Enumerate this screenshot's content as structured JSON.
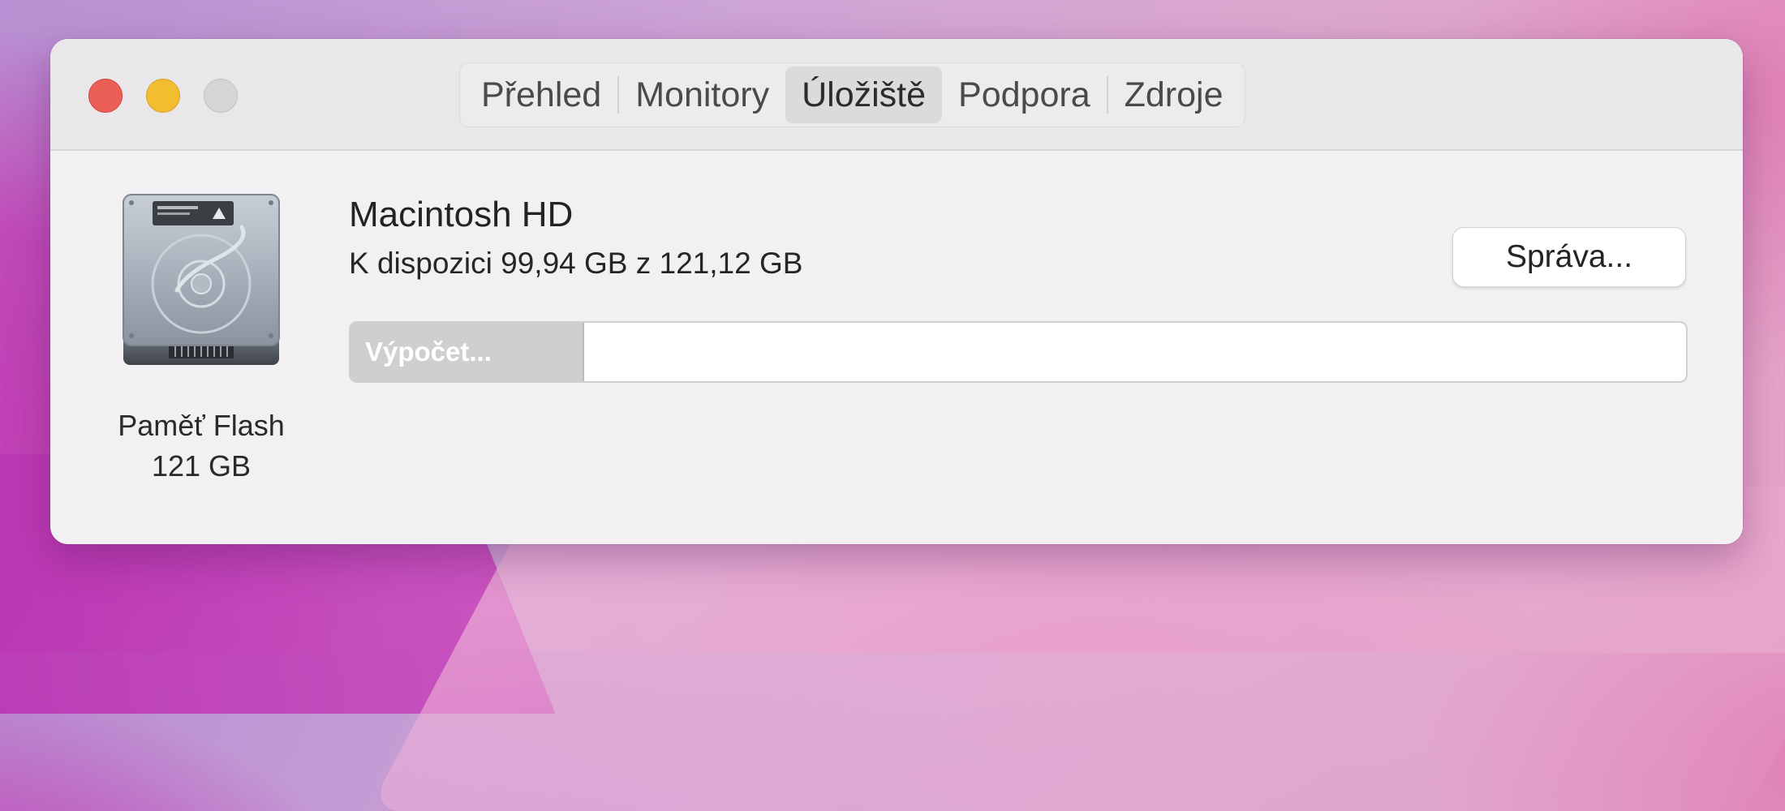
{
  "tabs": [
    {
      "label": "Přehled",
      "active": false
    },
    {
      "label": "Monitory",
      "active": false
    },
    {
      "label": "Úložiště",
      "active": true
    },
    {
      "label": "Podpora",
      "active": false
    },
    {
      "label": "Zdroje",
      "active": false
    }
  ],
  "drive": {
    "icon": "hard-drive-icon",
    "label_line1": "Paměť Flash",
    "label_line2": "121 GB"
  },
  "volume": {
    "name": "Macintosh HD",
    "availability": "K dispozici 99,94 GB z 121,12 GB",
    "manage_label": "Správa...",
    "bar_status": "Výpočet...",
    "bar_fill_fraction": 0.175
  },
  "colors": {
    "close": "#ec5f57",
    "minimize": "#f2bd2f",
    "zoom": "#d6d4d7",
    "bar_fill": "#cfcfd0"
  }
}
